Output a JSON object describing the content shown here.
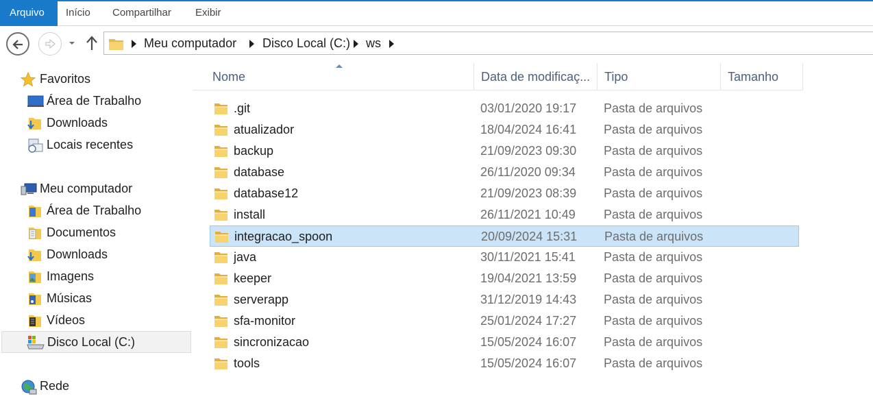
{
  "ribbon": {
    "tabs": [
      "Arquivo",
      "Início",
      "Compartilhar",
      "Exibir"
    ]
  },
  "address": {
    "crumbs": [
      "Meu computador",
      "Disco Local (C:)",
      "ws"
    ]
  },
  "nav": {
    "favorites_label": "Favoritos",
    "favorites": [
      "Área de Trabalho",
      "Downloads",
      "Locais recentes"
    ],
    "computer_label": "Meu computador",
    "computer": [
      "Área de Trabalho",
      "Documentos",
      "Downloads",
      "Imagens",
      "Músicas",
      "Vídeos",
      "Disco Local (C:)"
    ],
    "network_label": "Rede"
  },
  "columns": {
    "name": "Nome",
    "date": "Data de modificaç...",
    "type": "Tipo",
    "size": "Tamanho"
  },
  "files": [
    {
      "name": ".git",
      "date": "03/01/2020 19:17",
      "type": "Pasta de arquivos"
    },
    {
      "name": "atualizador",
      "date": "18/04/2024 16:41",
      "type": "Pasta de arquivos"
    },
    {
      "name": "backup",
      "date": "21/09/2023 09:30",
      "type": "Pasta de arquivos"
    },
    {
      "name": "database",
      "date": "26/11/2020 09:34",
      "type": "Pasta de arquivos"
    },
    {
      "name": "database12",
      "date": "21/09/2023 08:39",
      "type": "Pasta de arquivos"
    },
    {
      "name": "install",
      "date": "26/11/2021 10:49",
      "type": "Pasta de arquivos"
    },
    {
      "name": "integracao_spoon",
      "date": "20/09/2024 15:31",
      "type": "Pasta de arquivos"
    },
    {
      "name": "java",
      "date": "30/11/2021 15:41",
      "type": "Pasta de arquivos"
    },
    {
      "name": "keeper",
      "date": "19/04/2021 13:59",
      "type": "Pasta de arquivos"
    },
    {
      "name": "serverapp",
      "date": "31/12/2019 14:43",
      "type": "Pasta de arquivos"
    },
    {
      "name": "sfa-monitor",
      "date": "25/01/2024 17:27",
      "type": "Pasta de arquivos"
    },
    {
      "name": "sincronizacao",
      "date": "15/05/2024 16:07",
      "type": "Pasta de arquivos"
    },
    {
      "name": "tools",
      "date": "15/05/2024 16:07",
      "type": "Pasta de arquivos"
    }
  ],
  "colors": {
    "accent": "#1979ca",
    "selection": "#cce4f7",
    "folder": "#f2c94c"
  }
}
